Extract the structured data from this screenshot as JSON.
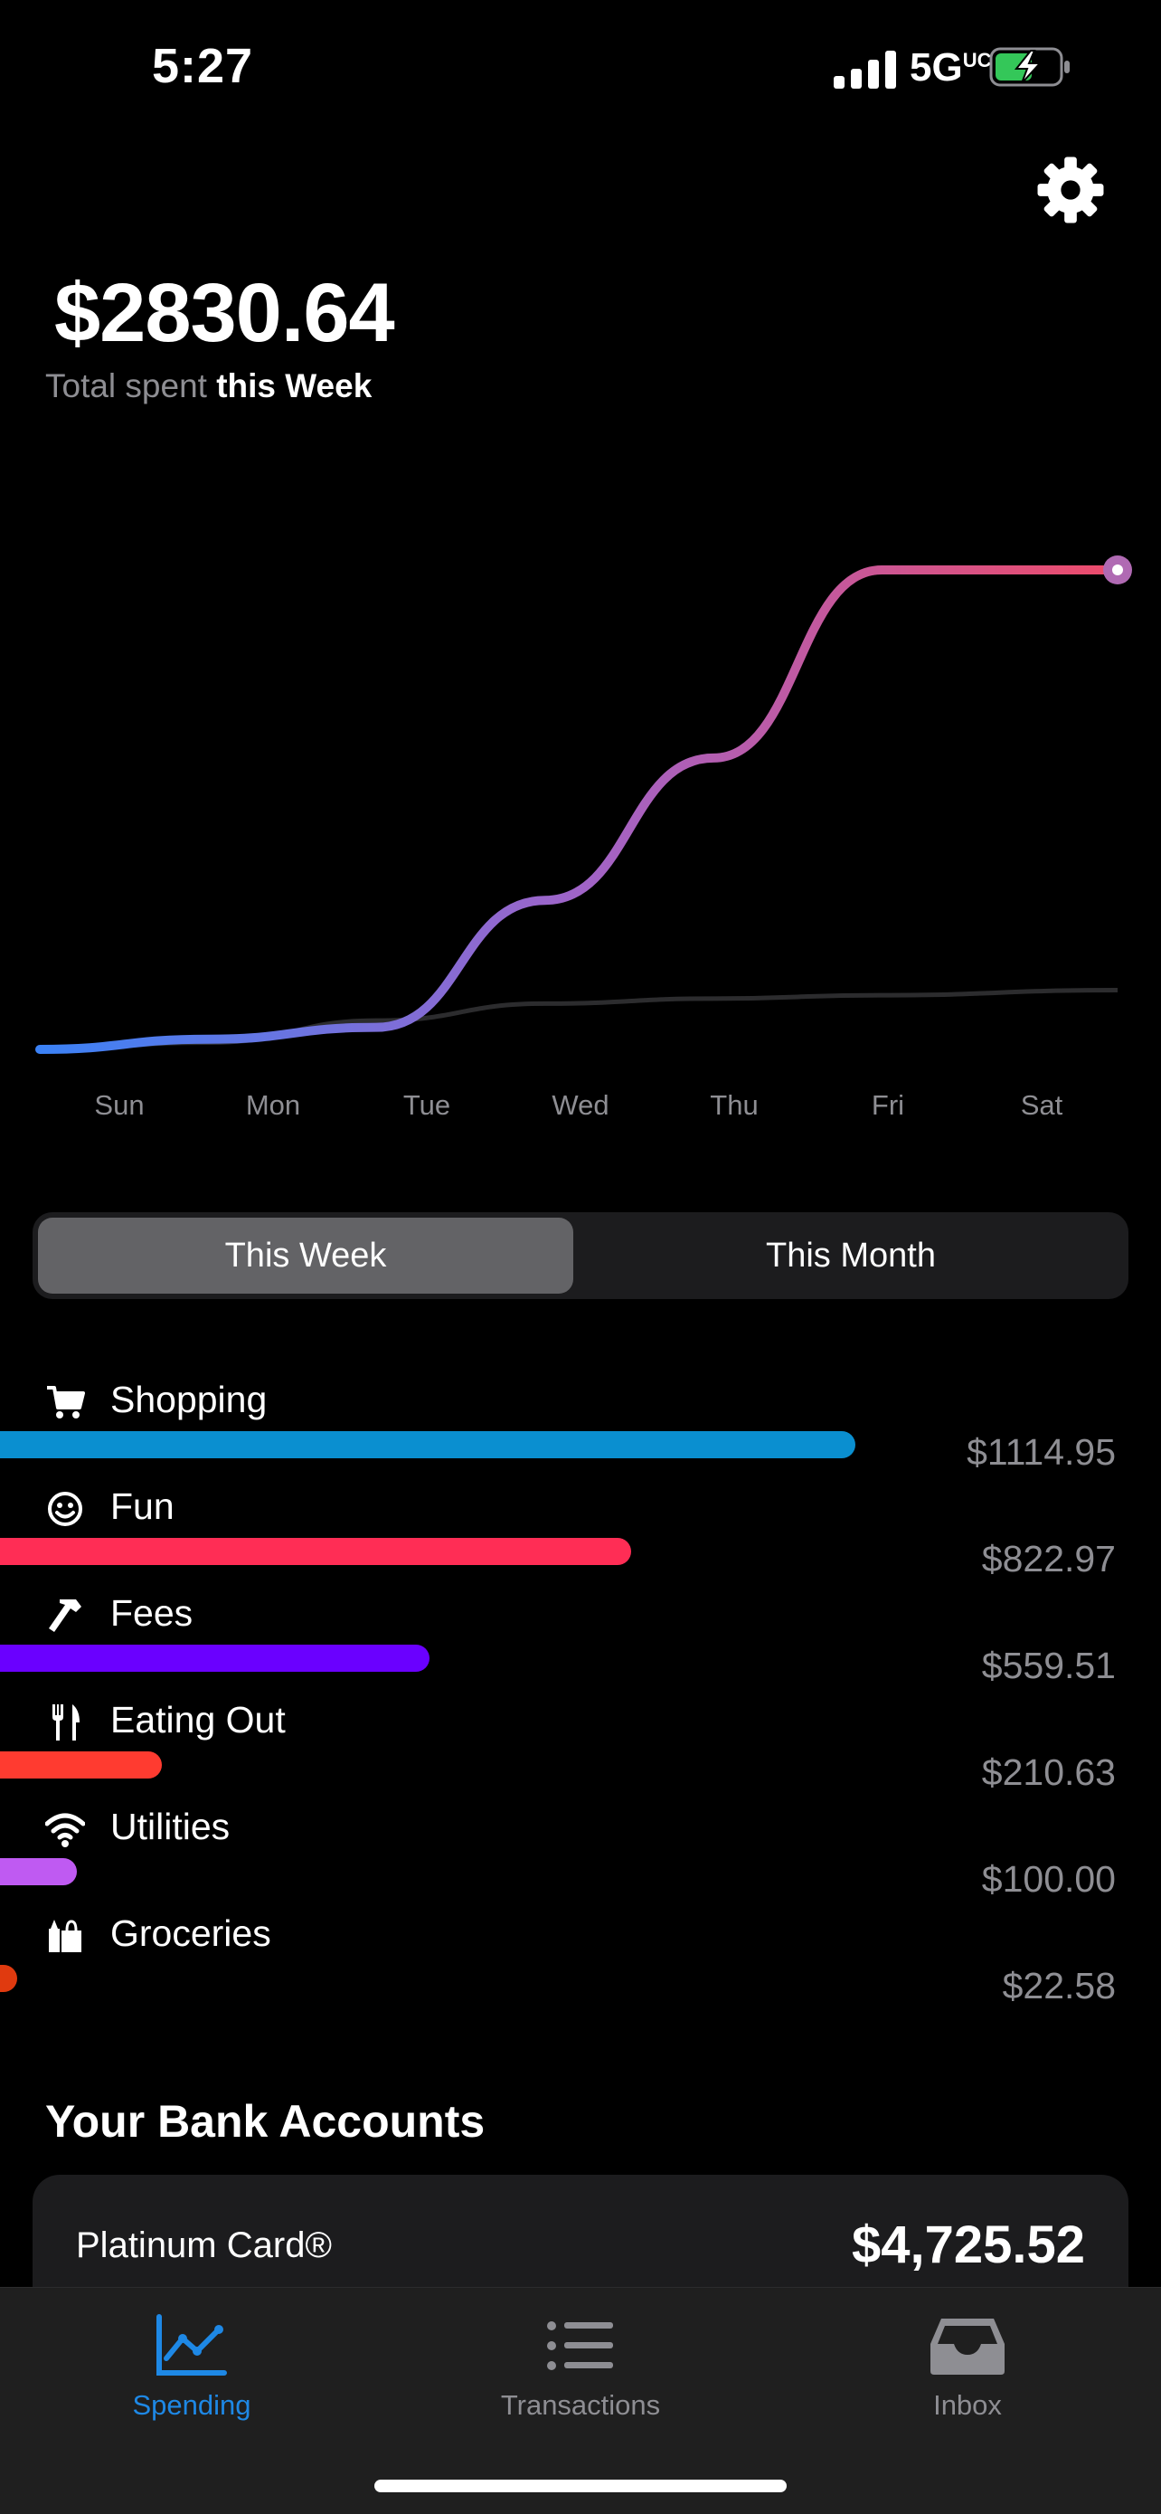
{
  "status": {
    "time": "5:27",
    "network": "5G",
    "network_suffix": "UC"
  },
  "header": {
    "total_amount": "$2830.64",
    "subtitle_prefix": "Total spent",
    "subtitle_period": "this Week",
    "settings_icon": "gear-icon"
  },
  "chart_data": {
    "type": "line",
    "x": [
      "Sun",
      "Mon",
      "Tue",
      "Wed",
      "Thu",
      "Fri",
      "Sat"
    ],
    "series": [
      {
        "values": [
          0,
          60,
          130,
          880,
          1720,
          2830,
          2830
        ],
        "color": "gradient #3b82f6 → #ee4b6a"
      },
      {
        "values": [
          0,
          40,
          170,
          270,
          300,
          320,
          350
        ],
        "color": "#2c2c2e"
      }
    ],
    "title": "",
    "xlabel": "",
    "ylabel": "",
    "grid": false,
    "endpoint_marker": true
  },
  "segments": {
    "active": "This Week",
    "inactive": "This Month"
  },
  "categories": [
    {
      "label": "Shopping",
      "amount": "$1114.95",
      "value": 1114.95,
      "color": "#0a8fd0",
      "icon": "cart-icon"
    },
    {
      "label": "Fun",
      "amount": "$822.97",
      "value": 822.97,
      "color": "#ff2d55",
      "icon": "smiley-icon"
    },
    {
      "label": "Fees",
      "amount": "$559.51",
      "value": 559.51,
      "color": "#6a00ff",
      "icon": "hammer-icon"
    },
    {
      "label": "Eating Out",
      "amount": "$210.63",
      "value": 210.63,
      "color": "#ff3b30",
      "icon": "fork-knife-icon"
    },
    {
      "label": "Utilities",
      "amount": "$100.00",
      "value": 100.0,
      "color": "#bf5af2",
      "icon": "wifi-icon"
    },
    {
      "label": "Groceries",
      "amount": "$22.58",
      "value": 22.58,
      "color": "#e03a0f",
      "icon": "grocery-bag-icon"
    }
  ],
  "bank": {
    "title": "Your Bank Accounts",
    "accounts": [
      {
        "name": "Platinum Card®",
        "balance": "$4,725.52"
      }
    ]
  },
  "tabs": [
    {
      "label": "Spending",
      "icon": "chart-icon",
      "active": true
    },
    {
      "label": "Transactions",
      "icon": "list-icon",
      "active": false
    },
    {
      "label": "Inbox",
      "icon": "inbox-tray-icon",
      "active": false
    }
  ]
}
